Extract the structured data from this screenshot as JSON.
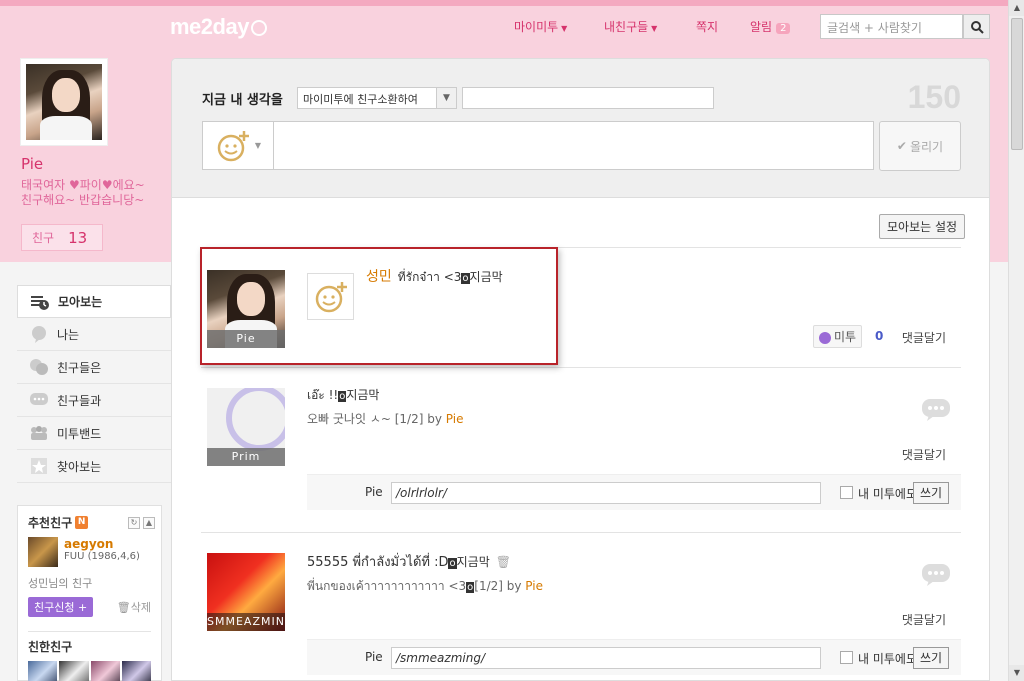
{
  "header": {
    "logo": "me2day",
    "nav": [
      {
        "label": "마이미투",
        "caret": "▼"
      },
      {
        "label": "내친구들",
        "caret": "▼"
      },
      {
        "label": "쪽지"
      },
      {
        "label": "알림",
        "badge": "2"
      }
    ],
    "search_placeholder": "글검색 + 사람찾기"
  },
  "profile": {
    "name": "Pie",
    "bio_line1": "태국여자 ♥파이♥에요~",
    "bio_line2": "친구해요~ 반갑습니당~",
    "friends_label": "친구",
    "friends_count": "13"
  },
  "side_menu": [
    {
      "label": "모아보는",
      "icon": "clock-stack-icon",
      "active": true
    },
    {
      "label": "나는",
      "icon": "speech-bubble-icon"
    },
    {
      "label": "친구들은",
      "icon": "two-bubbles-icon"
    },
    {
      "label": "친구들과",
      "icon": "chat-dots-icon"
    },
    {
      "label": "미투밴드",
      "icon": "group-icon"
    },
    {
      "label": "찾아보는",
      "icon": "star-icon"
    }
  ],
  "recommend": {
    "title": "추천친구",
    "badge": "N",
    "person_name": "aegyon",
    "person_sub": "FUU (1986,4,6)",
    "note": "성민님의 친구",
    "request_label": "친구신청 +",
    "delete_label": "삭제",
    "close_friends_title": "친한친구"
  },
  "post_box": {
    "label": "지금 내 생각을",
    "select_value": "마이미투에 친구소환하여",
    "char_count": "150",
    "submit_label": "올리기"
  },
  "feed_setting_label": "모아보는 설정",
  "posts": [
    {
      "avatar_label": "Pie",
      "author": "성민",
      "text_before": "ที่รักจ๋าา <3",
      "tag": "o",
      "text_after": "지금막",
      "metoo_label": "미투",
      "metoo_count": "0",
      "reply_label": "댓글달기"
    },
    {
      "avatar_label": "Prim",
      "text_before": "เอ๊ะ !!",
      "tag": "o",
      "text_after": "지금막",
      "meta_text": "오빠 굿나잇 ㅅ~ [1/2] by ",
      "meta_author": "Pie",
      "reply_label": "댓글달기",
      "comment_who": "Pie",
      "comment_value": "/olrlrlolr/",
      "checkbox_label": "내 미투에도",
      "write_label": "쓰기"
    },
    {
      "avatar_label": "SMMEAZMIN",
      "text_before": "55555 พี่กำลังมั่วได้ที่ :D",
      "tag": "o",
      "text_after": "지금막",
      "meta_text_before": "พี่นกของเค้าาาาาาาาาาาา <3",
      "meta_tag": "o",
      "meta_text": "[1/2] by ",
      "meta_author": "Pie",
      "reply_label": "댓글달기",
      "comment_who": "Pie",
      "comment_value": "/smmeazming/",
      "checkbox_label": "내 미투에도",
      "write_label": "쓰기"
    }
  ],
  "colors": {
    "brand_pink": "#f9d2de",
    "accent": "#d6336c",
    "author_orange": "#d67a00",
    "highlight_red": "#b8232a"
  }
}
